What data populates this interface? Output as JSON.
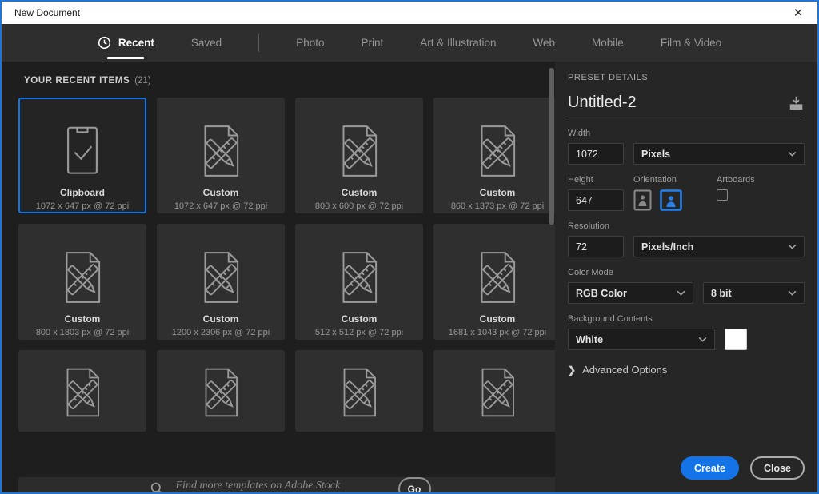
{
  "window": {
    "title": "New Document",
    "close_glyph": "✕"
  },
  "tabs": [
    {
      "label": "Recent",
      "active": true,
      "icon": "clock-icon"
    },
    {
      "label": "Saved",
      "divider_after": true
    },
    {
      "label": "Photo"
    },
    {
      "label": "Print"
    },
    {
      "label": "Art & Illustration"
    },
    {
      "label": "Web"
    },
    {
      "label": "Mobile"
    },
    {
      "label": "Film & Video"
    }
  ],
  "recent": {
    "heading": "YOUR RECENT ITEMS",
    "count": "(21)",
    "items": [
      {
        "name": "Clipboard",
        "dims": "1072 x 647 px @ 72 ppi",
        "icon": "clipboard-check-icon",
        "selected": true
      },
      {
        "name": "Custom",
        "dims": "1072 x 647 px @ 72 ppi",
        "icon": "document-ruler-pencil-icon"
      },
      {
        "name": "Custom",
        "dims": "800 x 600 px @ 72 ppi",
        "icon": "document-ruler-pencil-icon"
      },
      {
        "name": "Custom",
        "dims": "860 x 1373 px @ 72 ppi",
        "icon": "document-ruler-pencil-icon"
      },
      {
        "name": "Custom",
        "dims": "800 x 1803 px @ 72 ppi",
        "icon": "document-ruler-pencil-icon"
      },
      {
        "name": "Custom",
        "dims": "1200 x 2306 px @ 72 ppi",
        "icon": "document-ruler-pencil-icon"
      },
      {
        "name": "Custom",
        "dims": "512 x 512 px @ 72 ppi",
        "icon": "document-ruler-pencil-icon"
      },
      {
        "name": "Custom",
        "dims": "1681 x 1043 px @ 72 ppi",
        "icon": "document-ruler-pencil-icon"
      },
      {
        "partial": true,
        "icon": "document-ruler-pencil-icon"
      },
      {
        "partial": true,
        "icon": "document-ruler-pencil-icon"
      },
      {
        "partial": true,
        "icon": "document-ruler-pencil-icon"
      },
      {
        "partial": true,
        "icon": "document-ruler-pencil-icon"
      }
    ]
  },
  "search": {
    "placeholder": "Find more templates on Adobe Stock",
    "go_label": "Go"
  },
  "preset": {
    "heading": "PRESET DETAILS",
    "name_value": "Untitled-2",
    "width_label": "Width",
    "width_value": "1072",
    "width_unit": "Pixels",
    "height_label": "Height",
    "height_value": "647",
    "orientation_label": "Orientation",
    "artboards_label": "Artboards",
    "resolution_label": "Resolution",
    "resolution_value": "72",
    "resolution_unit": "Pixels/Inch",
    "color_mode_label": "Color Mode",
    "color_mode_value": "RGB Color",
    "bit_depth_value": "8 bit",
    "background_label": "Background Contents",
    "background_value": "White",
    "advanced_label": "Advanced Options",
    "create_label": "Create",
    "close_label": "Close"
  },
  "colors": {
    "accent_blue": "#1473e6",
    "window_border_blue": "#2374cf",
    "tabbar_bg": "#2e2e2e",
    "left_bg": "#1e1e1e",
    "card_bg": "#2f2f2f",
    "right_panel_bg": "#262626",
    "titlebar_bg": "#ffffff",
    "background_swatch": "#ffffff"
  }
}
